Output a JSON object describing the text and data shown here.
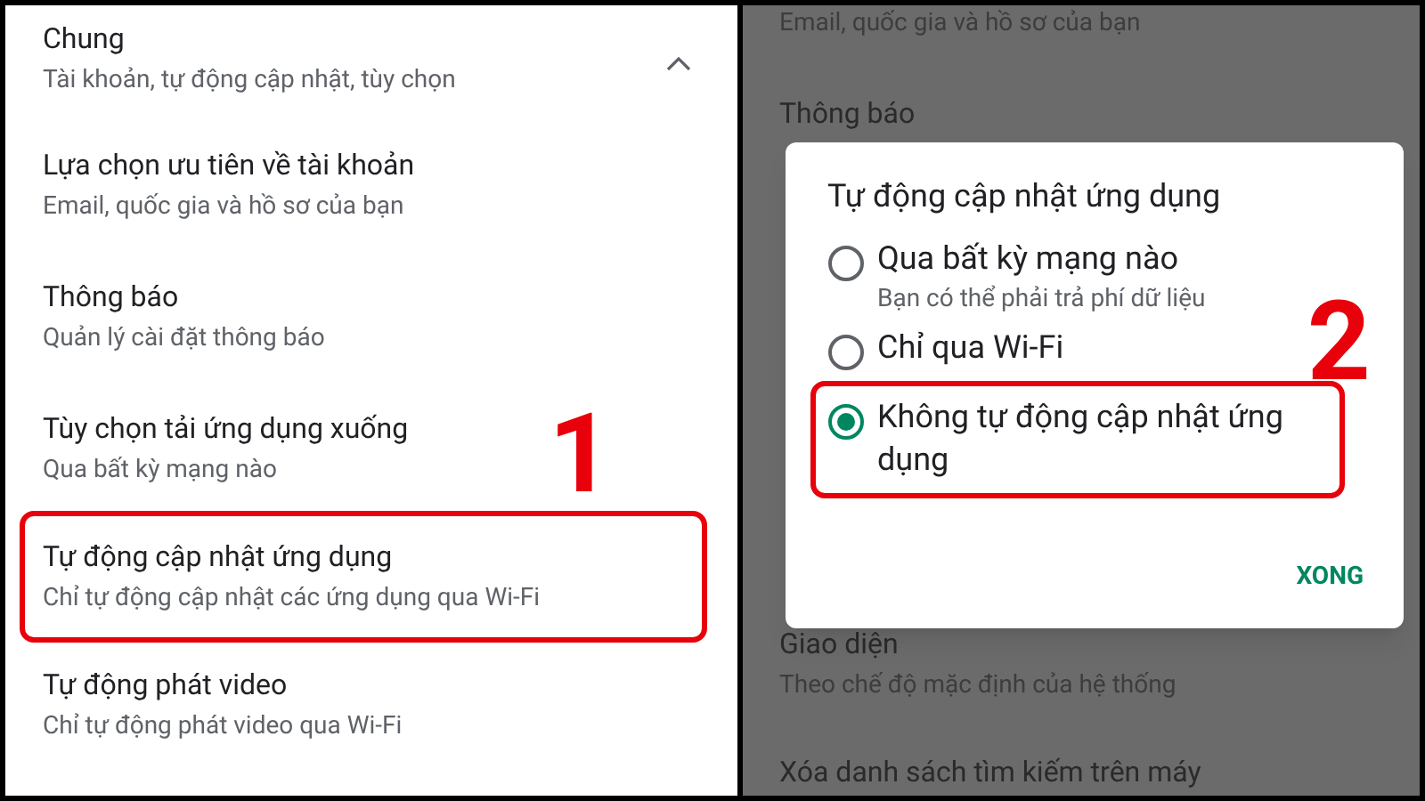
{
  "settings_panel": {
    "section": {
      "title": "Chung",
      "subtitle": "Tài khoản, tự động cập nhật, tùy chọn",
      "expanded": true
    },
    "items": [
      {
        "title": "Lựa chọn ưu tiên về tài khoản",
        "subtitle": "Email, quốc gia và hồ sơ của bạn",
        "highlighted": false
      },
      {
        "title": "Thông báo",
        "subtitle": "Quản lý cài đặt thông báo",
        "highlighted": false
      },
      {
        "title": "Tùy chọn tải ứng dụng xuống",
        "subtitle": "Qua bất kỳ mạng nào",
        "highlighted": false
      },
      {
        "title": "Tự động cập nhật ứng dụng",
        "subtitle": "Chỉ tự động cập nhật các ứng dụng qua Wi-Fi",
        "highlighted": true
      },
      {
        "title": "Tự động phát video",
        "subtitle": "Chỉ tự động phát video qua Wi-Fi",
        "highlighted": false
      }
    ],
    "step_label": "1"
  },
  "dimmed_panel": {
    "top_subtitle": "Email, quốc gia và hồ sơ của bạn",
    "top_title": "Thông báo",
    "bottom_title": "Giao diện",
    "bottom_subtitle": "Theo chế độ mặc định của hệ thống",
    "last_title": "Xóa danh sách tìm kiếm trên máy"
  },
  "dialog": {
    "title": "Tự động cập nhật ứng dụng",
    "options": [
      {
        "label": "Qua bất kỳ mạng nào",
        "subtitle": "Bạn có thể phải trả phí dữ liệu",
        "selected": false,
        "highlighted": false
      },
      {
        "label": "Chỉ qua Wi-Fi",
        "selected": false,
        "highlighted": false
      },
      {
        "label": "Không tự động cập nhật ứng dụng",
        "selected": true,
        "highlighted": true
      }
    ],
    "button": "XONG",
    "step_label": "2"
  }
}
